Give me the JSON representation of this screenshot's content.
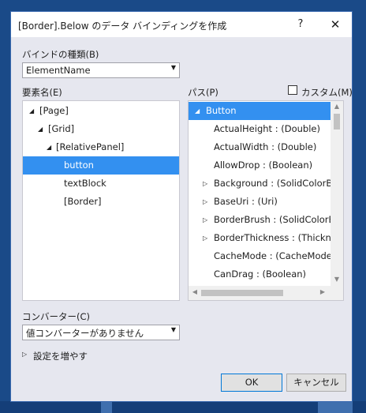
{
  "window": {
    "title": "[Border].Below のデータ バインディングを作成",
    "help_label": "?",
    "close_label": "✕"
  },
  "binding_type": {
    "label": "バインドの種類(B)",
    "selected": "ElementName"
  },
  "element_name": {
    "label": "要素名(E)",
    "items": [
      {
        "label": "[Page]",
        "expanded": true,
        "selected": false
      },
      {
        "label": "[Grid]",
        "expanded": true,
        "selected": false
      },
      {
        "label": "[RelativePanel]",
        "expanded": true,
        "selected": false
      },
      {
        "label": "button",
        "expanded": null,
        "selected": true
      },
      {
        "label": "textBlock",
        "expanded": null,
        "selected": false
      },
      {
        "label": "[Border]",
        "expanded": null,
        "selected": false
      }
    ]
  },
  "path": {
    "label": "パス(P)",
    "custom_label": "カスタム(M)",
    "custom_checked": false,
    "items": [
      {
        "label": "Button",
        "expandable": "open",
        "selected": true
      },
      {
        "label": "ActualHeight : (Double)",
        "expandable": null,
        "selected": false
      },
      {
        "label": "ActualWidth : (Double)",
        "expandable": null,
        "selected": false
      },
      {
        "label": "AllowDrop : (Boolean)",
        "expandable": null,
        "selected": false
      },
      {
        "label": "Background : (SolidColorBrush)",
        "expandable": "closed",
        "selected": false
      },
      {
        "label": "BaseUri : (Uri)",
        "expandable": "closed",
        "selected": false
      },
      {
        "label": "BorderBrush : (SolidColorBrush)",
        "expandable": "closed",
        "selected": false
      },
      {
        "label": "BorderThickness : (Thickness)",
        "expandable": "closed",
        "selected": false
      },
      {
        "label": "CacheMode : (CacheMode)",
        "expandable": null,
        "selected": false
      },
      {
        "label": "CanDrag : (Boolean)",
        "expandable": null,
        "selected": false
      }
    ]
  },
  "converter": {
    "label": "コンバーター(C)",
    "selected": "値コンバーターがありません"
  },
  "more_settings": {
    "label": "設定を増やす"
  },
  "buttons": {
    "ok_label": "OK",
    "cancel_label": "キャンセル"
  },
  "colors": {
    "selection": "#3390f0",
    "dialog_bg": "#e6e7ef",
    "default_button_border": "#0078d7"
  }
}
